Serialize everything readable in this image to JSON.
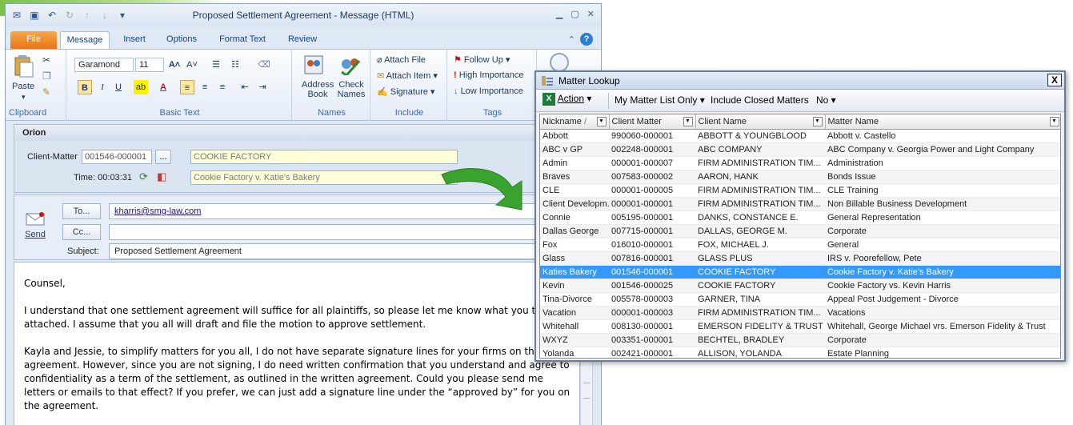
{
  "outlook": {
    "window_title": "Proposed Settlement Agreement  -  Message (HTML)",
    "tabs": [
      "File",
      "Message",
      "Insert",
      "Options",
      "Format Text",
      "Review"
    ],
    "ribbon": {
      "clipboard": {
        "paste": "Paste",
        "label": "Clipboard"
      },
      "basic_text": {
        "font": "Garamond",
        "size": "11",
        "label": "Basic Text"
      },
      "names": {
        "address_book_1": "Address",
        "address_book_2": "Book",
        "check_names_1": "Check",
        "check_names_2": "Names",
        "label": "Names"
      },
      "include": {
        "attach_file": "Attach File",
        "attach_item": "Attach Item",
        "signature": "Signature",
        "label": "Include"
      },
      "tags": {
        "follow_up": "Follow Up",
        "high_importance": "High Importance",
        "low_importance": "Low Importance",
        "label": "Tags"
      }
    },
    "orion": {
      "title": "Orion",
      "client_matter_label": "Client-Matter",
      "client_matter_value": "001546-000001",
      "browse": "...",
      "client_name": "COOKIE FACTORY",
      "time_label": "Time: 00:03:31",
      "matter_name": "Cookie Factory v. Katie's Bakery"
    },
    "header": {
      "send": "Send",
      "to_label": "To...",
      "to_value": "kharris@smg-law.com",
      "cc_label": "Cc...",
      "cc_value": "",
      "subject_label": "Subject:",
      "subject_value": "Proposed Settlement Agreement"
    },
    "body": {
      "p1": "Counsel,",
      "p2": "I understand that one settlement agreement will suffice for all plaintiffs, so please let me know what you thi the attached.  I assume that you all will draft and file the motion to approve settlement.",
      "p3": "Kayla and Jessie, to simplify matters for you all, I do not have separate signature lines for your firms on this agreement.  However, since you are not signing, I do need written confirmation that you understand and agree to confidentiality as a term of the settlement, as outlined in the written agreement.  Could you please send me letters or emails to that effect?  If you prefer, we can just add a signature line under the “approved by” for you on the agreement."
    }
  },
  "lookup": {
    "title": "Matter Lookup",
    "close": "X",
    "toolbar": {
      "action": "Action",
      "my_matter_list": "My Matter List Only",
      "include_closed": "Include Closed Matters",
      "include_closed_value": "No"
    },
    "columns": [
      "Nickname",
      "Client Matter",
      "Client Name",
      "Matter Name"
    ],
    "selected_row": 10,
    "rows": [
      [
        "Abbott",
        "990060-000001",
        "ABBOTT & YOUNGBLOOD",
        "Abbott v. Castello"
      ],
      [
        "ABC v GP",
        "002248-000001",
        "ABC COMPANY",
        "ABC Company v. Georgia Power and Light Company"
      ],
      [
        "Admin",
        "000001-000007",
        "FIRM ADMINISTRATION TIM...",
        "Administration"
      ],
      [
        "Braves",
        "007583-000002",
        "AARON, HANK",
        "Bonds Issue"
      ],
      [
        "CLE",
        "000001-000005",
        "FIRM ADMINISTRATION TIM...",
        "CLE Training"
      ],
      [
        "Client Developm...",
        "000001-000001",
        "FIRM ADMINISTRATION TIM...",
        "Non Billable Business Development"
      ],
      [
        "Connie",
        "005195-000001",
        "DANKS, CONSTANCE E.",
        "General Representation"
      ],
      [
        "Dallas George",
        "007715-000001",
        "DALLAS, GEORGE M.",
        "Corporate"
      ],
      [
        "Fox",
        "016010-000001",
        "FOX, MICHAEL J.",
        "General"
      ],
      [
        "Glass",
        "007816-000001",
        "GLASS PLUS",
        "IRS v. Poorefellow, Pete"
      ],
      [
        "Katies Bakery",
        "001546-000001",
        "COOKIE FACTORY",
        "Cookie Factory v. Katie's Bakery"
      ],
      [
        "Kevin",
        "001546-000025",
        "COOKIE FACTORY",
        "Cookie Factory vs. Kevin Harris"
      ],
      [
        "Tina-Divorce",
        "005578-000003",
        "GARNER, TINA",
        "Appeal Post Judgement - Divorce"
      ],
      [
        "Vacation",
        "000001-000003",
        "FIRM ADMINISTRATION TIM...",
        "Vacations"
      ],
      [
        "Whitehall",
        "008130-000001",
        "EMERSON FIDELITY & TRUST",
        "Whitehall, George Michael vrs. Emerson Fidelity & Trust"
      ],
      [
        "WXYZ",
        "003351-000001",
        "BECHTEL, BRADLEY",
        "Corporate"
      ],
      [
        "Yolanda",
        "002421-000001",
        "ALLISON, YOLANDA",
        "Estate Planning"
      ]
    ]
  },
  "colors": {
    "selection": "#3399ff",
    "arrow": "#3aa22f",
    "file_tab": "#e8741a"
  }
}
